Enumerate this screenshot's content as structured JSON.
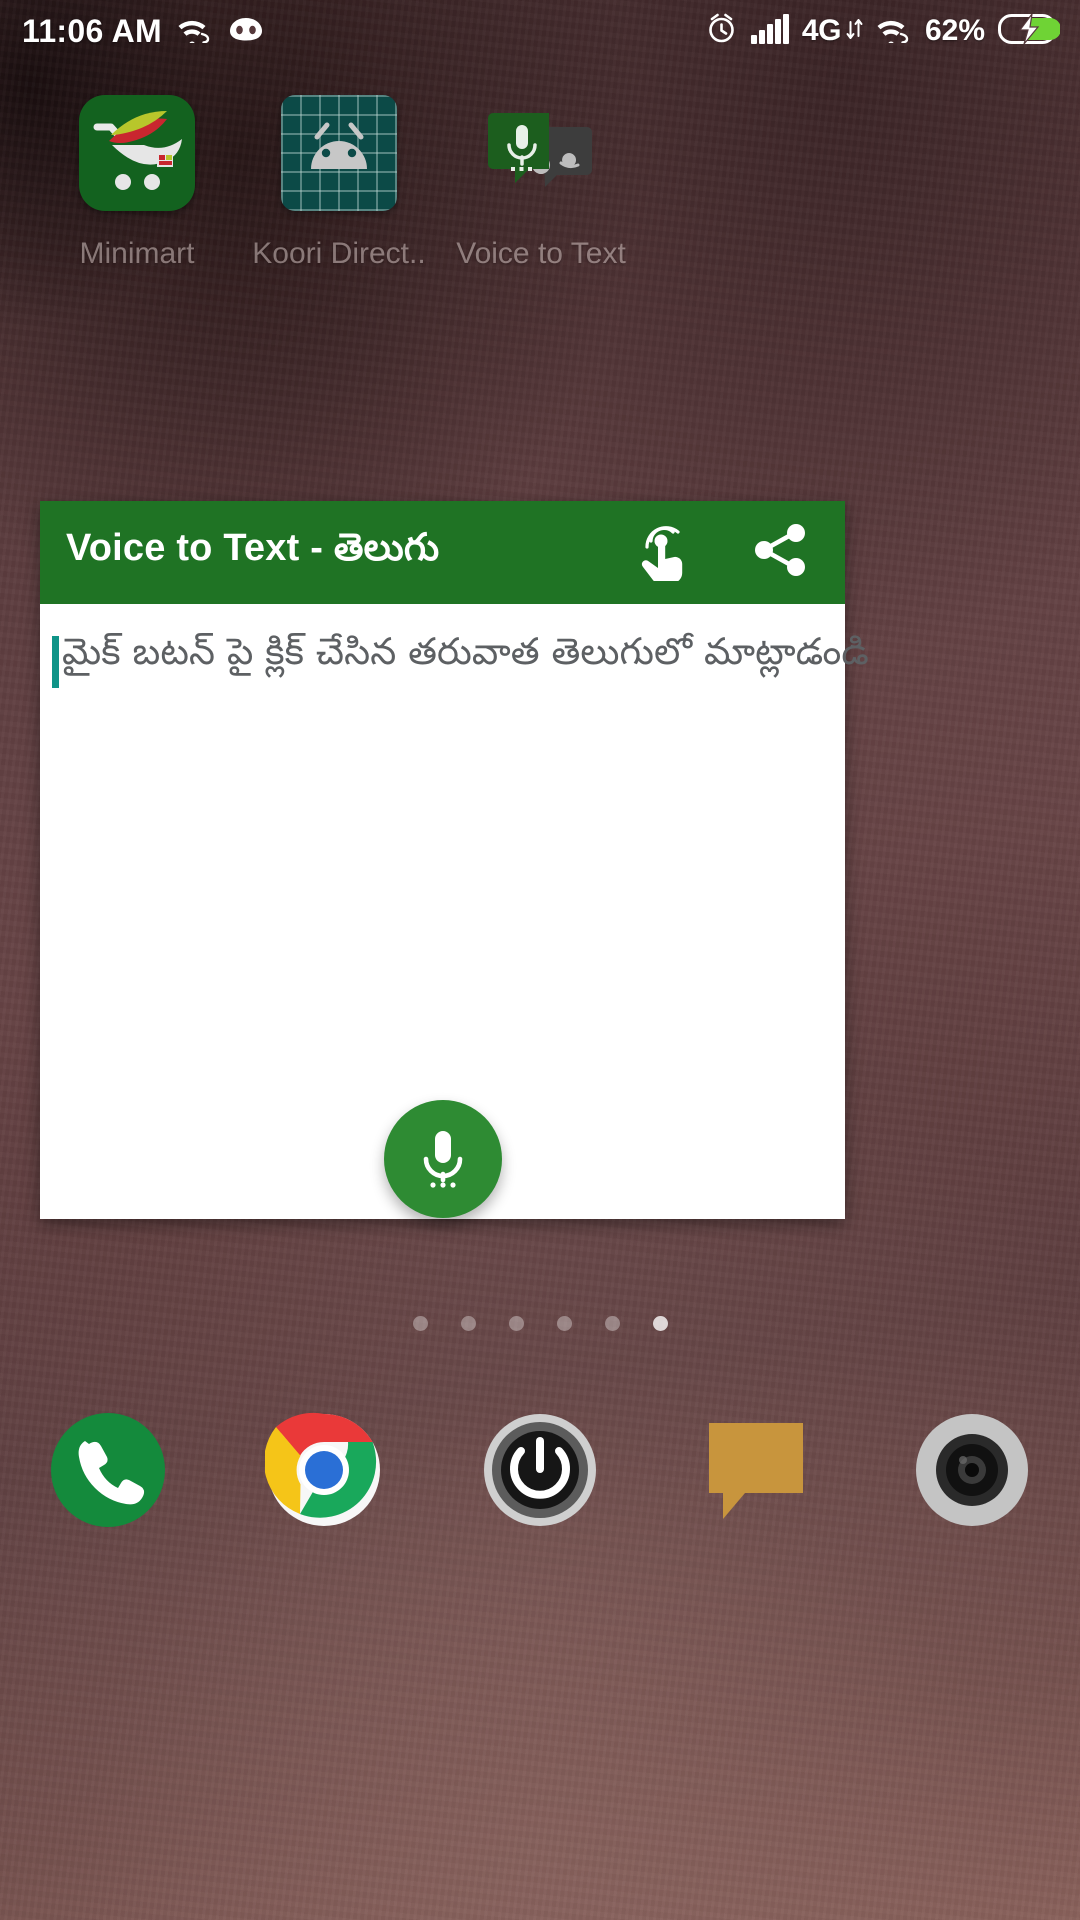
{
  "status_bar": {
    "time": "11:06 AM",
    "wifi_left_icon": "wifi-icon",
    "cyanogen_icon": "cyanogenmod-icon",
    "alarm_icon": "alarm-clock-icon",
    "signal_icon": "cellular-signal-icon",
    "network_type": "4G",
    "data_transfer_icon": "data-updown-icon",
    "wifi_right_icon": "wifi-icon",
    "battery_percent": "62%",
    "battery_icon": "battery-charging-icon"
  },
  "home_screen": {
    "apps": [
      {
        "label": "Minimart",
        "icon": "minimart-cart-icon"
      },
      {
        "label": "Koori Direct..",
        "icon": "android-grid-icon"
      },
      {
        "label": "Voice to Text",
        "icon": "voice-to-text-bubble-icon"
      }
    ],
    "page_dots": {
      "count": 6,
      "active_index": 5
    },
    "dock": [
      {
        "name": "phone",
        "icon": "phone-icon"
      },
      {
        "name": "chrome",
        "icon": "chrome-browser-icon"
      },
      {
        "name": "power",
        "icon": "power-button-icon"
      },
      {
        "name": "messaging",
        "icon": "message-bubble-icon"
      },
      {
        "name": "camera",
        "icon": "camera-lens-icon"
      }
    ]
  },
  "app_card": {
    "title": "Voice to Text - తెలుగు",
    "header_buttons": [
      {
        "name": "touch-gesture-button",
        "icon": "touch-tap-icon"
      },
      {
        "name": "share-button",
        "icon": "share-icon"
      }
    ],
    "text_field": {
      "placeholder": "మైక్ బటన్ పై క్లిక్ చేసిన తరువాత తెలుగులో మాట్లాడండి",
      "value": "",
      "caret_color": "#0f9488"
    },
    "mic_button": {
      "name": "mic-record-button",
      "icon": "microphone-icon"
    },
    "colors": {
      "header": "#1f7324",
      "fab": "#2e8b33",
      "body": "#ffffff"
    }
  }
}
